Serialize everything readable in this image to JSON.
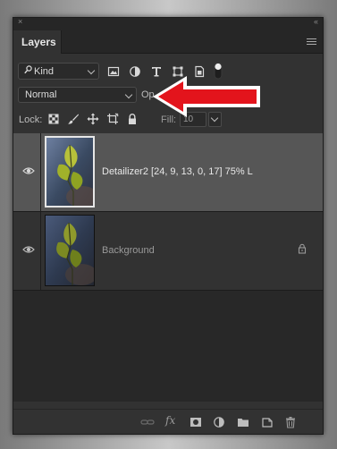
{
  "window": {
    "close_glyph": "×",
    "collapse_glyph": "‹‹"
  },
  "panel": {
    "tab_label": "Layers"
  },
  "filter": {
    "kind_label": "Kind",
    "icons": [
      "pixel-filter-icon",
      "adjustment-filter-icon",
      "type-filter-icon",
      "shape-filter-icon",
      "smart-object-filter-icon",
      "filter-toggle-icon"
    ]
  },
  "blend": {
    "mode_label": "Normal",
    "opacity_label": "Op"
  },
  "lock": {
    "label": "Lock:",
    "icons": [
      "lock-transparent-icon",
      "lock-image-icon",
      "lock-position-icon",
      "lock-artboard-icon",
      "lock-all-icon"
    ],
    "fill_label": "Fill:",
    "fill_value": "10"
  },
  "layers": [
    {
      "name": "Detailizer2 [24, 9, 13, 0, 17] 75% L",
      "selected": true,
      "visible": true
    },
    {
      "name": "Background",
      "selected": false,
      "visible": true,
      "locked": true
    }
  ],
  "footer": {
    "icons": [
      "link-icon",
      "fx-icon",
      "mask-icon",
      "adjustment-icon",
      "group-icon",
      "new-layer-icon",
      "trash-icon"
    ],
    "fx_label": "fx"
  },
  "annotation": {
    "arrow_color": "#e3141c"
  }
}
